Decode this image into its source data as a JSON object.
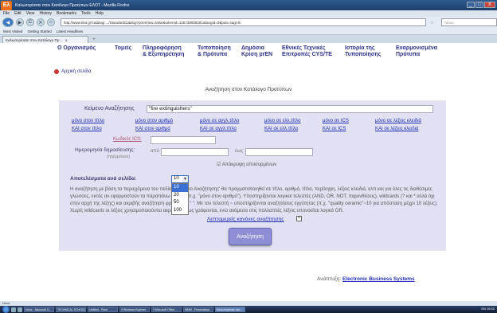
{
  "window": {
    "title": "Καλωσορίσατε στον Κατάλογο Προτύπων ΕΛΟΤ - Mozilla Firefox",
    "app_icon": "Ελ",
    "buttons": [
      "_",
      "□",
      "X"
    ]
  },
  "menu": [
    "File",
    "Edit",
    "View",
    "History",
    "Bookmarks",
    "Tools",
    "Help"
  ],
  "nav": {
    "back": "◀",
    "forward": "▶",
    "reload": "C",
    "stop": "✕",
    "home": "⌂",
    "url": "http://www.elot.gr/catalog/..../StandardCatalog?printView=false&tokenId=125738008281&langId=0&pub=sagAll=",
    "search_placeholder": "Yahoo"
  },
  "bookmarks": [
    "Most Visited",
    "Getting Started",
    "Latest Headlines"
  ],
  "tabs": [
    {
      "label": "Καλωσορίσατε στον Κατάλογο Πρ...",
      "close": "x"
    }
  ],
  "newtab": "+",
  "site_nav": [
    {
      "l1": "Ο Οργανισμός",
      "l2": ""
    },
    {
      "l1": "Τομείς",
      "l2": ""
    },
    {
      "l1": "Πληροφόρηση",
      "l2": "& Εξυπηρέτηση"
    },
    {
      "l1": "Τυποποίηση",
      "l2": "& Πρότυπα"
    },
    {
      "l1": "Δημόσια",
      "l2": "Κρίση prEN"
    },
    {
      "l1": "Εθνικές Τεχνικές",
      "l2": "Επιτροπές CYS/TE"
    },
    {
      "l1": "Ιστορία της",
      "l2": "Τυποποίησης"
    },
    {
      "l1": "Εναρμονισμένα",
      "l2": "Πρότυπα"
    }
  ],
  "breadcrumb": "Αρχική σελίδα",
  "page_title": "Αναζήτηση στον Κατάλογο Προτύπων",
  "form": {
    "search_label": "Κείμενο Αναζήτησης",
    "search_value": "\"fire extinguishers\"",
    "options_row1": [
      "μόνο στον τίτλο",
      "μόνο στον αριθμό",
      "μόνο σε αγγλ.τίτλο",
      "μόνο σε ελλ.τίτλο",
      "μόνο σε ICS",
      "μόνο σε λέξεις κλειδιά"
    ],
    "options_row2": [
      "ΚΑΙ στον τίτλο",
      "ΚΑΙ στον αριθμό",
      "ΚΑΙ σε αγγλ.τίτλο",
      "ΚΑΙ σε ελλ.τίτλο",
      "ΚΑΙ σε ICS",
      "ΚΑΙ σε λέξεις κλειδιά"
    ],
    "ics_label": "Κωδικός ICS:",
    "date_label": "Ημερομηνία δημοσίευσης:",
    "date_format": "(ηη/μμ/εεεε)",
    "from_label": "από",
    "to_label": "έως",
    "hide_withdrawn": "Απόκρυψη αποσυρμένων",
    "results_label": "Αποτελέσματα ανά σελίδα:",
    "results_value": "10",
    "results_options": [
      "10",
      "20",
      "50",
      "100"
    ],
    "help_text": "Η αναζήτηση με βάση τα περιεχόμενα του πεδίου 'Κείμενο Αναζήτησης' θα πραγματοποιηθεί σε τίτλο, αριθμό, τίτλο, περίληψη, λέξεις κλειδιά, κλπ και για όλες τις διαθέσιμες γλώσσες, εκτός αν εφαρμοστούν τα παραπάνω φίλτρα (π.χ. \"μόνο στον αριθμό\"). Υποστηρίζονται λογικοί τελεστές (AND, OR, NOT, παρενθέσεις), wildcards (? και * αλλά όχι στην αρχή της λέξης) και ακριβής αναζήτηση φράσης με \" \". Με τον τελεστή ~ υποστηρίζονται αναζητήσεις εγγύτητας (π.χ. \"quality ceramic\"~10 για απόσταση μέχρι 10 λέξεις). Χωρίς wildcards οι λέξεις χρησιμοποιούνται ακριβώς όπως γράφονται, ενώ ανάμεσα στις πολλαπλές λέξεις υπονοείται λογικό OR.",
    "rules_link": "Λεπτομερείς κανόνες αναζήτησης",
    "rules_expand": "+",
    "submit": "Αναζήτηση"
  },
  "footer": {
    "prefix": "Ανάπτυξη:",
    "link": "Electronic Business Systems"
  },
  "status": "Done",
  "taskbar": {
    "items": [
      "Inbox - Microsoft O...",
      "TECHNICAL SCHOOL",
      "Untitled - Paint",
      "3 Windows Explorer",
      "3 Microsoft Office...",
      "MMM - Presentation",
      "Καλωσορίσατε στο..."
    ],
    "clock": "EN 15:42"
  },
  "colors": {
    "accent": "#2b2f8a",
    "panel": "#e1e1f3",
    "link": "#1f2eb5",
    "button": "#8e8ed6"
  }
}
